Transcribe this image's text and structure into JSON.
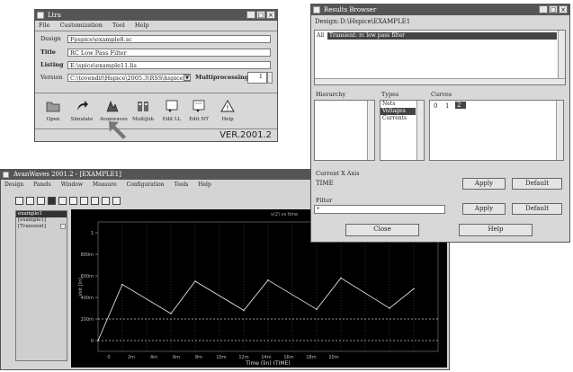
{
  "launcher": {
    "title": "Ltra",
    "menu": [
      "File",
      "Customization",
      "Tool",
      "Help"
    ],
    "design_label": "Design",
    "design_value": "Fpspice\\example8.sc",
    "title_label": "Title",
    "title_value": "RC Low Pass Filter",
    "listing_label": "Listing",
    "listing_value": "E:\\spice\\example11.lis",
    "version_label": "Version",
    "version_value": "C:\\tovendit\\Hspice\\2005.3\\RSS\\hspice.exe",
    "multiproc_label": "Multiprocessing",
    "multiproc_value": "1",
    "tools": [
      {
        "label": "Open",
        "icon": "folder-icon"
      },
      {
        "label": "Simulate",
        "icon": "run-arrow-icon"
      },
      {
        "label": "Avanwaves",
        "icon": "waveform-viewer-icon"
      },
      {
        "label": "MultiJob",
        "icon": "multijob-icon"
      },
      {
        "label": "Edit LL",
        "icon": "edit-icon"
      },
      {
        "label": "Edit NT",
        "icon": "edit-netlist-icon"
      },
      {
        "label": "Help",
        "icon": "help-icon"
      }
    ],
    "version_stamp": "VER.2001.2"
  },
  "results": {
    "title": "Results Browser",
    "design_label": "Design:",
    "design_value": "D:\\Hspice\\EXAMPLE1",
    "list_label": "All",
    "list_item": "Transient: rc low pass filter",
    "hierarchy_label": "Hierarchy",
    "types_label": "Types",
    "types": [
      "Nets",
      "Voltages",
      "Currents"
    ],
    "types_selected_index": 1,
    "curves_label": "Curves",
    "curves": [
      "0",
      "1",
      "2"
    ],
    "curves_selected_index": 2,
    "xaxis_label": "Current X Axis",
    "xaxis_value": "TIME",
    "apply_label": "Apply",
    "default_label": "Default",
    "filter_label": "Filter",
    "filter_value": "*",
    "close_label": "Close",
    "help_label": "Help"
  },
  "waveview": {
    "title": "AvanWaves 2001.2 - [EXAMPLE1]",
    "menu": [
      "Design",
      "Panels",
      "Window",
      "Measure",
      "Configuration",
      "Tools",
      "Help"
    ],
    "tree_items": [
      "example1",
      "[example1]",
      "[Transient]"
    ],
    "chart_title": "v(2) vs time",
    "axis_label": "Volt [lin]",
    "x_axis_label": "Time (lin) (TIME)",
    "y_ticks": [
      "1",
      "800m",
      "600m",
      "400m",
      "200m",
      "0"
    ],
    "x_ticks": [
      "0",
      "2m",
      "4m",
      "6m",
      "8m",
      "10m",
      "12m",
      "14m",
      "16m",
      "18m",
      "20m"
    ],
    "chart_data": {
      "type": "line",
      "x": [
        0,
        1,
        3,
        4,
        6,
        7,
        9,
        10,
        12,
        13
      ],
      "values": [
        0,
        0.52,
        0.25,
        0.55,
        0.28,
        0.56,
        0.29,
        0.58,
        0.3,
        0.48
      ],
      "xlabel": "Time (lin) (TIME)",
      "ylabel": "Volt [lin]",
      "ylim": [
        -0.1,
        1.1
      ]
    }
  },
  "colors": {
    "titlebar": "#555555",
    "window": "#d8d8d8",
    "selection": "#444444",
    "plot_bg": "#000000",
    "trace": "#dddddd"
  }
}
